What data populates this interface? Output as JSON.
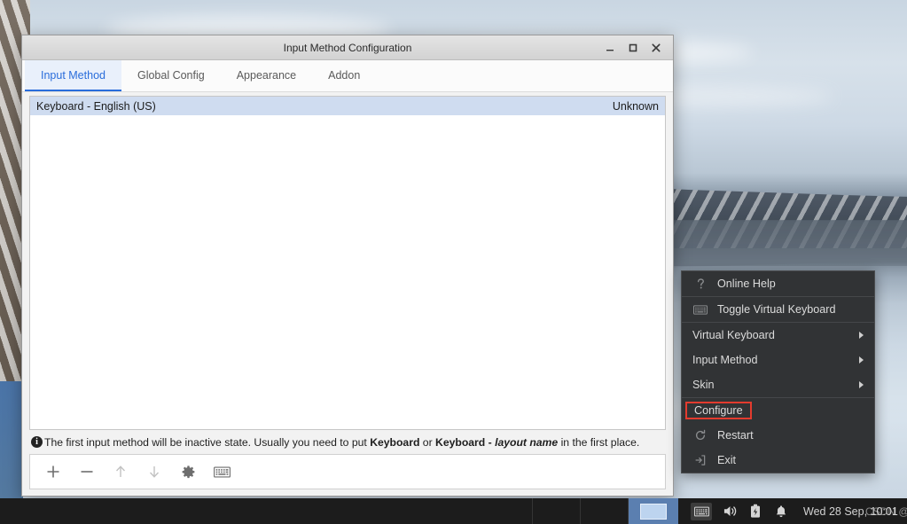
{
  "window": {
    "title": "Input Method Configuration",
    "controls": {
      "minimize": "minimize-icon",
      "maximize": "maximize-icon",
      "close": "close-icon"
    }
  },
  "tabs": [
    {
      "label": "Input Method",
      "active": true
    },
    {
      "label": "Global Config",
      "active": false
    },
    {
      "label": "Appearance",
      "active": false
    },
    {
      "label": "Addon",
      "active": false
    }
  ],
  "input_method_list": {
    "rows": [
      {
        "name": "Keyboard - English (US)",
        "language": "Unknown"
      }
    ]
  },
  "hint": {
    "part1": "The first input method will be inactive state. Usually you need to put ",
    "bold1": "Keyboard",
    "mid": " or ",
    "bold2": "Keyboard - ",
    "italic": "layout name",
    "part2": " in the first place."
  },
  "toolbar": {
    "buttons": [
      {
        "name": "add-input-method-button",
        "icon": "plus-icon",
        "enabled": true
      },
      {
        "name": "remove-input-method-button",
        "icon": "minus-icon",
        "enabled": true
      },
      {
        "name": "move-up-button",
        "icon": "arrow-up-icon",
        "enabled": false
      },
      {
        "name": "move-down-button",
        "icon": "arrow-down-icon",
        "enabled": false
      },
      {
        "name": "configure-input-method-button",
        "icon": "gear-icon",
        "enabled": true
      },
      {
        "name": "virtual-keyboard-button",
        "icon": "keyboard-icon",
        "enabled": true
      }
    ]
  },
  "context_menu": {
    "items": [
      {
        "label": "Online Help",
        "icon": "question-mark-icon",
        "submenu": false,
        "highlighted": false
      },
      {
        "label": "Toggle Virtual Keyboard",
        "icon": "keyboard-icon",
        "submenu": false,
        "highlighted": false
      },
      {
        "label": "Virtual Keyboard",
        "icon": "",
        "submenu": true,
        "highlighted": false
      },
      {
        "label": "Input Method",
        "icon": "",
        "submenu": true,
        "highlighted": false
      },
      {
        "label": "Skin",
        "icon": "",
        "submenu": true,
        "highlighted": false
      },
      {
        "label": "Configure",
        "icon": "",
        "submenu": false,
        "highlighted": true
      },
      {
        "label": "Restart",
        "icon": "refresh-icon",
        "submenu": false,
        "highlighted": false
      },
      {
        "label": "Exit",
        "icon": "exit-icon",
        "submenu": false,
        "highlighted": false
      }
    ],
    "highlight_color": "#e33b2e"
  },
  "taskbar": {
    "tray": [
      {
        "name": "keyboard-tray-icon"
      },
      {
        "name": "volume-tray-icon"
      },
      {
        "name": "battery-tray-icon"
      },
      {
        "name": "notification-bell-icon"
      }
    ],
    "clock": "Wed 28 Sep, 10:01",
    "watermark": "CSDN @alfiyZha"
  },
  "colors": {
    "accent": "#2a6ddb",
    "selection": "#cfdcf0",
    "menu_bg": "#313335",
    "taskbar_bg": "#1c1c1c",
    "highlight": "#e33b2e"
  }
}
